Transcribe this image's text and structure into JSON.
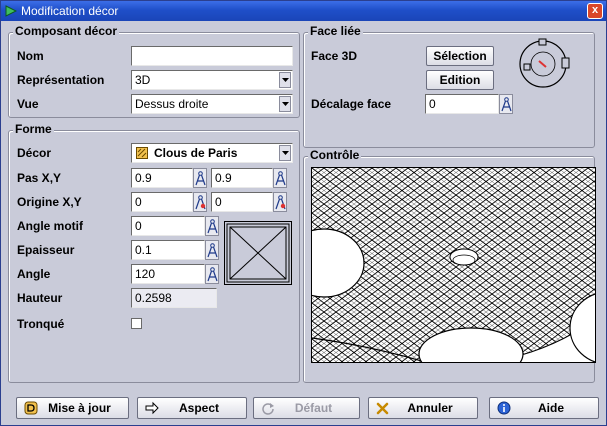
{
  "window": {
    "title": "Modification décor",
    "close": "x"
  },
  "composant": {
    "title": "Composant décor",
    "nom_label": "Nom",
    "nom_value": "",
    "representation_label": "Représentation",
    "representation_value": "3D",
    "vue_label": "Vue",
    "vue_value": "Dessus droite"
  },
  "forme": {
    "title": "Forme",
    "decor_label": "Décor",
    "decor_value": "Clous de Paris",
    "pas_label": "Pas X,Y",
    "pas_x": "0.9",
    "pas_y": "0.9",
    "origine_label": "Origine X,Y",
    "origine_x": "0",
    "origine_y": "0",
    "angle_motif_label": "Angle motif",
    "angle_motif_value": "0",
    "epaisseur_label": "Epaisseur",
    "epaisseur_value": "0.1",
    "angle_label": "Angle",
    "angle_value": "120",
    "hauteur_label": "Hauteur",
    "hauteur_value": "0.2598",
    "tronque_label": "Tronqué",
    "tronque_checked": false
  },
  "face": {
    "title": "Face liée",
    "face3d_label": "Face 3D",
    "selection_button": "Sélection",
    "edition_button": "Edition",
    "decalage_label": "Décalage face",
    "decalage_value": "0"
  },
  "controle": {
    "title": "Contrôle"
  },
  "footer": {
    "mise_a_jour": "Mise à jour",
    "aspect": "Aspect",
    "defaut": "Défaut",
    "annuler": "Annuler",
    "aide": "Aide"
  },
  "colors": {
    "dialog_bg": "#c9cbd9",
    "titlebar": "#1f4fc9",
    "close": "#d9472a"
  }
}
